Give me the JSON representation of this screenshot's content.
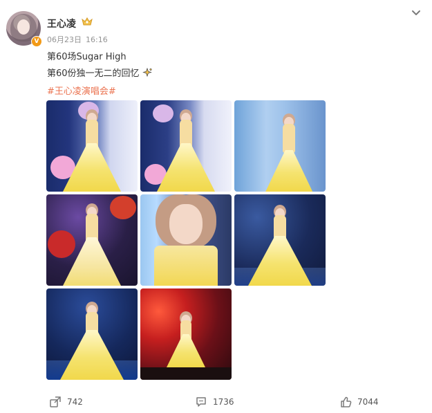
{
  "post": {
    "username": "王心凌",
    "date": "06月23日",
    "time": "16:16",
    "line1": "第60场Sugar High",
    "line2": "第60份独一无二的回忆",
    "hashtag": "#王心凌演唱会#",
    "verified_badge": "V",
    "icons": {
      "crown": "crown-icon",
      "sparkle": "sparkle-icon",
      "chevron": "chevron-down-icon"
    }
  },
  "actions": {
    "share_count": "742",
    "comment_count": "1736",
    "like_count": "7044"
  },
  "colors": {
    "hashtag": "#eb7350",
    "meta": "#939393",
    "badge": "#f29a17"
  }
}
